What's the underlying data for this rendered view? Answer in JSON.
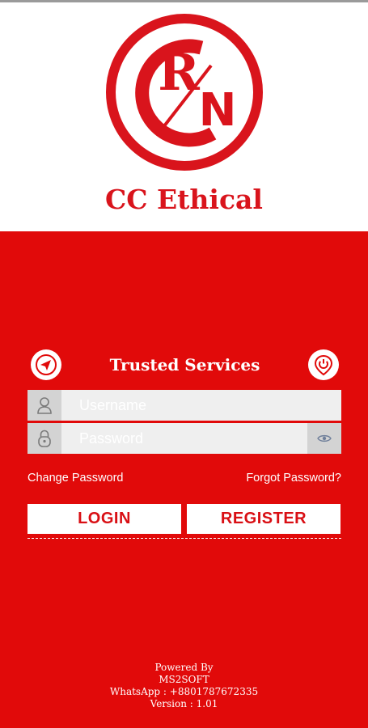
{
  "header": {
    "logo_name": "crn-logo",
    "app_name": "CC Ethical"
  },
  "panel": {
    "title": "Trusted Services",
    "left_icon": "send-icon",
    "right_icon": "power-pin-icon"
  },
  "form": {
    "username_placeholder": "Username",
    "username_icon": "user-icon",
    "password_placeholder": "Password",
    "password_icon": "lock-icon",
    "toggle_icon": "eye-icon"
  },
  "links": {
    "change_password": "Change Password",
    "forgot_password": "Forgot Password?"
  },
  "buttons": {
    "login": "LOGIN",
    "register": "REGISTER"
  },
  "footer": {
    "powered_by": "Powered By",
    "company": "MS2SOFT",
    "whatsapp": "WhatsApp : +8801787672335",
    "version": "Version : 1.01"
  },
  "colors": {
    "brand_red": "#e10a0a",
    "logo_red": "#d9141c",
    "white": "#ffffff"
  }
}
